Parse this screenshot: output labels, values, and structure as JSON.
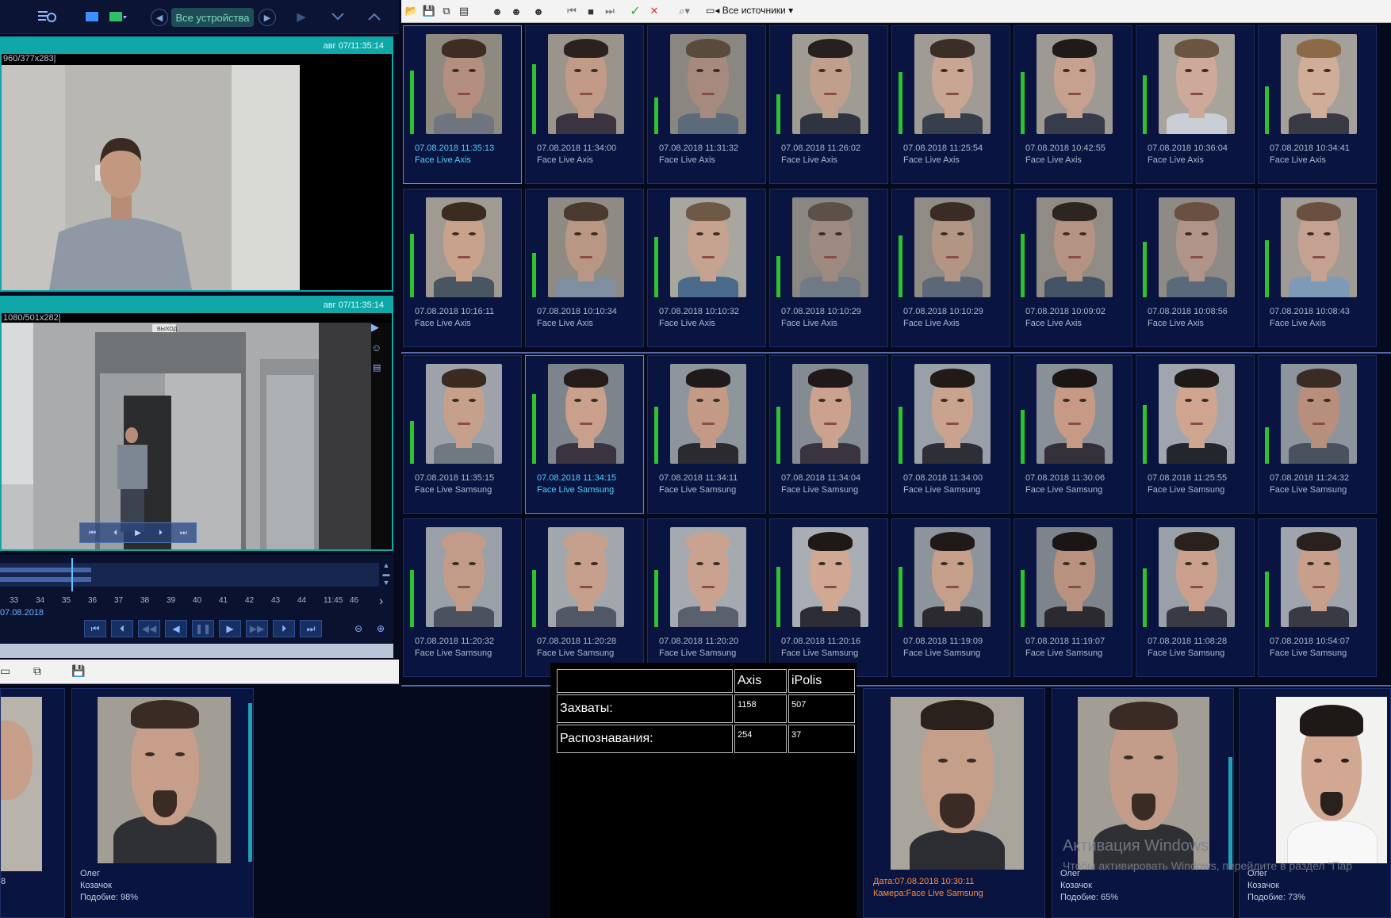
{
  "left_toolbar": {
    "devices_label": "Все устройства"
  },
  "cam1": {
    "timestamp": "авг 07/11:35:14",
    "info": "960/377x283|"
  },
  "cam2": {
    "timestamp": "авг 07/11:35:14",
    "info": "1080/501x282|",
    "door_sign": "ВЫХОД"
  },
  "timeline": {
    "ticks": [
      "33",
      "34",
      "35",
      "36",
      "37",
      "38",
      "39",
      "40",
      "41",
      "42",
      "43",
      "44",
      "11:45",
      "46"
    ],
    "date": "07.08.2018"
  },
  "right_toolbar": {
    "sources_label": "Все источники"
  },
  "captures": {
    "rows": [
      [
        {
          "time": "07.08.2018 11:35:13",
          "source": "Face Live Axis",
          "selected": true,
          "bar": 80,
          "skin": "#b48e7e",
          "hair": "#3e2d24",
          "bg": "#8f8a80",
          "shirt": "#6f757f"
        },
        {
          "time": "07.08.2018 11:34:00",
          "source": "Face Live Axis",
          "selected": false,
          "bar": 88,
          "skin": "#c29a88",
          "hair": "#2c221d",
          "bg": "#9a948c",
          "shirt": "#3a3440"
        },
        {
          "time": "07.08.2018 11:31:32",
          "source": "Face Live Axis",
          "selected": false,
          "bar": 46,
          "skin": "#a58a7d",
          "hair": "#5a4a3c",
          "bg": "#8a8680",
          "shirt": "#5c6a7a"
        },
        {
          "time": "07.08.2018 11:26:02",
          "source": "Face Live Axis",
          "selected": false,
          "bar": 50,
          "skin": "#c0a08d",
          "hair": "#262020",
          "bg": "#a19c93",
          "shirt": "#2f3540"
        },
        {
          "time": "07.08.2018 11:25:54",
          "source": "Face Live Axis",
          "selected": false,
          "bar": 78,
          "skin": "#c9a593",
          "hair": "#3a2e26",
          "bg": "#a09b95",
          "shirt": "#383f4c"
        },
        {
          "time": "07.08.2018 10:42:55",
          "source": "Face Live Axis",
          "selected": false,
          "bar": 78,
          "skin": "#c7a18f",
          "hair": "#201a18",
          "bg": "#9e9992",
          "shirt": "#363c4a"
        },
        {
          "time": "07.08.2018 10:36:04",
          "source": "Face Live Axis",
          "selected": false,
          "bar": 74,
          "skin": "#cca998",
          "hair": "#6b5540",
          "bg": "#a8a39b",
          "shirt": "#c9ced6"
        },
        {
          "time": "07.08.2018 10:34:41",
          "source": "Face Live Axis",
          "selected": false,
          "bar": 60,
          "skin": "#d0ad99",
          "hair": "#8c6a48",
          "bg": "#a5a09a",
          "shirt": "#3a3a44"
        }
      ],
      [
        {
          "time": "07.08.2018 10:16:11",
          "source": "Face Live Axis",
          "selected": false,
          "bar": 80,
          "skin": "#c9a28c",
          "hair": "#3b2c22",
          "bg": "#a09a93",
          "shirt": "#4a5562"
        },
        {
          "time": "07.08.2018 10:10:34",
          "source": "Face Live Axis",
          "selected": false,
          "bar": 56,
          "skin": "#b89884",
          "hair": "#4a3a30",
          "bg": "#8f8a83",
          "shirt": "#7f8f9f"
        },
        {
          "time": "07.08.2018 10:10:32",
          "source": "Face Live Axis",
          "selected": false,
          "bar": 76,
          "skin": "#c6a390",
          "hair": "#6e5846",
          "bg": "#a9a59f",
          "shirt": "#4a6a8a"
        },
        {
          "time": "07.08.2018 10:10:29",
          "source": "Face Live Axis",
          "selected": false,
          "bar": 52,
          "skin": "#9e8a80",
          "hair": "#5d5048",
          "bg": "#8a8782",
          "shirt": "#707a86"
        },
        {
          "time": "07.08.2018 10:10:29",
          "source": "Face Live Axis",
          "selected": false,
          "bar": 78,
          "skin": "#b39584",
          "hair": "#3a2c24",
          "bg": "#908b85",
          "shirt": "#5c6878"
        },
        {
          "time": "07.08.2018 10:09:02",
          "source": "Face Live Axis",
          "selected": false,
          "bar": 80,
          "skin": "#b49382",
          "hair": "#2f2520",
          "bg": "#908b84",
          "shirt": "#445266"
        },
        {
          "time": "07.08.2018 10:08:56",
          "source": "Face Live Axis",
          "selected": false,
          "bar": 70,
          "skin": "#b0948a",
          "hair": "#6a5040",
          "bg": "#8e8a85",
          "shirt": "#5a6a7a"
        },
        {
          "time": "07.08.2018 10:08:43",
          "source": "Face Live Axis",
          "selected": false,
          "bar": 72,
          "skin": "#c4a190",
          "hair": "#6a5040",
          "bg": "#a09b95",
          "shirt": "#7e9ab6"
        }
      ],
      [
        {
          "time": "07.08.2018 11:35:15",
          "source": "Face Live Samsung",
          "selected": false,
          "bar": 54,
          "skin": "#c6a08a",
          "hair": "#3a2a20",
          "bg": "#9ea3ab",
          "shirt": "#707882"
        },
        {
          "time": "07.08.2018 11:34:15",
          "source": "Face Live Samsung",
          "selected": true,
          "bar": 88,
          "skin": "#c8a08c",
          "hair": "#241c18",
          "bg": "#7e848c",
          "shirt": "#3a3440"
        },
        {
          "time": "07.08.2018 11:34:11",
          "source": "Face Live Samsung",
          "selected": false,
          "bar": 72,
          "skin": "#c29a85",
          "hair": "#20191a",
          "bg": "#8f959d",
          "shirt": "#2a2a30"
        },
        {
          "time": "07.08.2018 11:34:04",
          "source": "Face Live Samsung",
          "selected": false,
          "bar": 72,
          "skin": "#caa28d",
          "hair": "#20191a",
          "bg": "#858b93",
          "shirt": "#3a3440"
        },
        {
          "time": "07.08.2018 11:34:00",
          "source": "Face Live Samsung",
          "selected": false,
          "bar": 72,
          "skin": "#c9a38e",
          "hair": "#221a17",
          "bg": "#9aa0a8",
          "shirt": "#2e2e36"
        },
        {
          "time": "07.08.2018 11:30:06",
          "source": "Face Live Samsung",
          "selected": false,
          "bar": 68,
          "skin": "#c69a85",
          "hair": "#1b1514",
          "bg": "#8a9098",
          "shirt": "#33303a"
        },
        {
          "time": "07.08.2018 11:25:55",
          "source": "Face Live Samsung",
          "selected": false,
          "bar": 74,
          "skin": "#cfa590",
          "hair": "#1f1a18",
          "bg": "#a1a6ae",
          "shirt": "#24262e"
        },
        {
          "time": "07.08.2018 11:24:32",
          "source": "Face Live Samsung",
          "selected": false,
          "bar": 46,
          "skin": "#b88e7c",
          "hair": "#3a2c24",
          "bg": "#8e949c",
          "shirt": "#4a5260"
        }
      ],
      [
        {
          "time": "07.08.2018 11:20:32",
          "source": "Face Live Samsung",
          "selected": false,
          "bar": 72,
          "skin": "#c29c88",
          "hair": "#c29c88",
          "bg": "#9aa0a8",
          "shirt": "#4a5260"
        },
        {
          "time": "07.08.2018 11:20:28",
          "source": "Face Live Samsung",
          "selected": false,
          "bar": 72,
          "skin": "#c6a08c",
          "hair": "#c6a08c",
          "bg": "#a2a7ae",
          "shirt": "#505866"
        },
        {
          "time": "07.08.2018 11:20:20",
          "source": "Face Live Samsung",
          "selected": false,
          "bar": 72,
          "skin": "#c9a38f",
          "hair": "#c9a38f",
          "bg": "#a5aab1",
          "shirt": "#58606e"
        },
        {
          "time": "07.08.2018 11:20:16",
          "source": "Face Live Samsung",
          "selected": false,
          "bar": 76,
          "skin": "#d0a894",
          "hair": "#1e1816",
          "bg": "#a9aeb4",
          "shirt": "#2c2c34"
        },
        {
          "time": "07.08.2018 11:19:09",
          "source": "Face Live Samsung",
          "selected": false,
          "bar": 76,
          "skin": "#c69f8a",
          "hair": "#201917",
          "bg": "#8e949c",
          "shirt": "#2a2a30"
        },
        {
          "time": "07.08.2018 11:19:07",
          "source": "Face Live Samsung",
          "selected": false,
          "bar": 72,
          "skin": "#b8927f",
          "hair": "#1b1514",
          "bg": "#7e848c",
          "shirt": "#2a2a30"
        },
        {
          "time": "07.08.2018 11:08:28",
          "source": "Face Live Samsung",
          "selected": false,
          "bar": 74,
          "skin": "#caa08c",
          "hair": "#2a201c",
          "bg": "#9aa0a8",
          "shirt": "#3a3a44"
        },
        {
          "time": "07.08.2018 10:54:07",
          "source": "Face Live Samsung",
          "selected": false,
          "bar": 70,
          "skin": "#c89f8b",
          "hair": "#2a201c",
          "bg": "#a0a5ad",
          "shirt": "#3a3a44"
        }
      ]
    ]
  },
  "stats": {
    "col1": "Axis",
    "col2": "iPolis",
    "rows": [
      {
        "label": "Захваты:",
        "axis": "1158",
        "ipolis": "507"
      },
      {
        "label": "Распознавания:",
        "axis": "254",
        "ipolis": "37"
      }
    ]
  },
  "match_left": {
    "partial_suffix": "8",
    "card": {
      "first": "Олег",
      "last": "Козачок",
      "similarity": "Подобие: 98%"
    }
  },
  "event": {
    "date": "Дата:07.08.2018 10:30:11",
    "camera": "Камера:Face Live Samsung"
  },
  "matches_right": [
    {
      "first": "Олег",
      "last": "Козачок",
      "similarity": "Подобие: 65%"
    },
    {
      "first": "Олег",
      "last": "Козачок",
      "similarity": "Подобие: 73%"
    }
  ],
  "watermark": {
    "title": "Активация Windows",
    "subtitle": "Чтобы активировать Windows, перейдите в раздел \"Пар"
  },
  "colors": {
    "accent_teal": "#0fa7a8",
    "quality_green": "#2ec32e",
    "selected_text": "#4fd0ff",
    "event_orange": "#ff8c3a"
  }
}
